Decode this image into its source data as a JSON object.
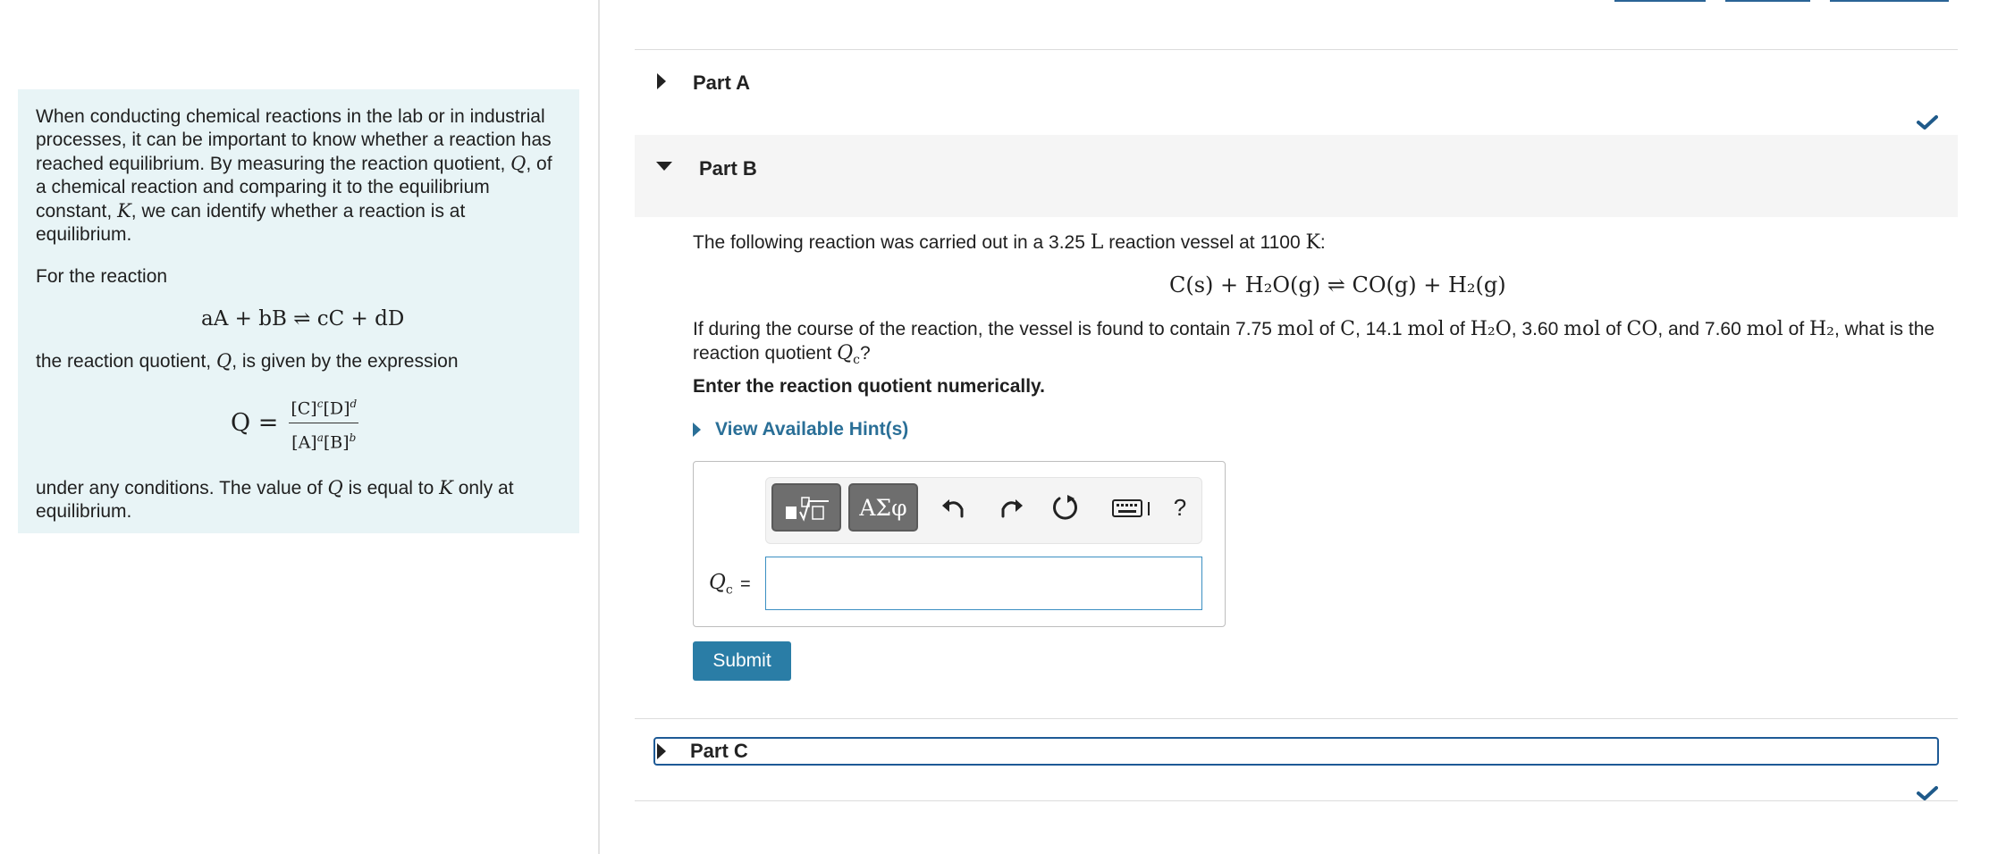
{
  "intro": {
    "para1_before_q": "When conducting chemical reactions in the lab or in industrial processes, it can be important to know whether a reaction has reached equilibrium. By measuring the reaction quotient,",
    "q_sym": "Q",
    "para1_mid": ", of a chemical reaction and comparing it to the equilibrium constant,",
    "k_sym": "K",
    "para1_after": ", we can identify whether a reaction is at equilibrium.",
    "for_reaction": "For the reaction",
    "general_reaction": "aA + bB ⇌ cC + dD",
    "quotient_before": "the reaction quotient,",
    "quotient_after": ", is given by the expression",
    "q_lhs": "Q =",
    "numerator": "[C]",
    "numerator_exp1": "c",
    "numerator_2": "[D]",
    "numerator_exp2": "d",
    "denominator": "[A]",
    "denominator_exp1": "a",
    "denominator_2": "[B]",
    "denominator_exp2": "b",
    "final_before": "under any conditions. The value of",
    "final_mid": "is equal to",
    "final_after": "only at equilibrium."
  },
  "partA": {
    "title": "Part A",
    "status": "complete"
  },
  "partB": {
    "title": "Part B",
    "intro_before": "The following reaction was carried out in a 3.25",
    "unit_L": "L",
    "intro_mid": "reaction vessel at 1100",
    "unit_K": "K",
    "colon": ":",
    "reaction": "C(s) + H₂O(g) ⇌ CO(g) + H₂(g)",
    "question_1": "If during the course of the reaction, the vessel is found to contain 7.75",
    "q_mol1": "mol",
    "q_of1": "of",
    "q_C": "C",
    "q_2": ", 14.1",
    "q_mol2": "mol",
    "q_of2": "of",
    "q_H2O": "H₂O",
    "q_3": ", 3.60",
    "q_mol3": "mol",
    "q_of3": "of",
    "q_CO": "CO",
    "q_4": ", and 7.60",
    "q_mol4": "mol",
    "q_of4": "of",
    "q_H2": "H₂",
    "q_5": ", what is the",
    "question_2": "reaction quotient",
    "qc": "Q",
    "qc_sub": "c",
    "question_end": "?",
    "instruction": "Enter the reaction quotient numerically.",
    "hint_link": "View Available Hint(s)",
    "toolbar": {
      "templates_icon": "templates-icon",
      "symbols_label": "ΑΣφ",
      "undo_icon": "undo-icon",
      "redo_icon": "redo-icon",
      "reset_icon": "reset-icon",
      "keyboard_icon": "keyboard-icon",
      "help_label": "?"
    },
    "answer_label": "Q",
    "answer_label_sub": "c",
    "answer_eq": "=",
    "answer_value": "",
    "submit_label": "Submit"
  },
  "partC": {
    "title": "Part C",
    "status": "complete"
  },
  "colors": {
    "accent": "#2a7da6",
    "check": "#1f5a8a",
    "intro_bg": "#e8f4f6",
    "focus": "#1e5a96"
  }
}
